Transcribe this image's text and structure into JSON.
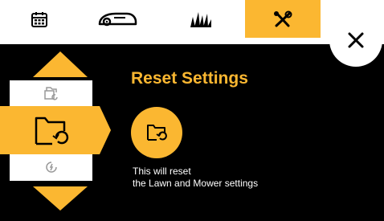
{
  "tabs": [
    {
      "id": "calendar",
      "icon": "calendar-icon",
      "active": false
    },
    {
      "id": "mower",
      "icon": "mower-icon",
      "active": false
    },
    {
      "id": "lawn",
      "icon": "grass-icon",
      "active": false
    },
    {
      "id": "settings",
      "icon": "tools-icon",
      "active": true
    }
  ],
  "close": {
    "icon": "close-icon"
  },
  "menu": {
    "items": [
      {
        "icon": "settings-item-icon",
        "state": "above"
      },
      {
        "icon": "folder-reset-icon",
        "state": "selected"
      },
      {
        "icon": "power-reset-icon",
        "state": "below"
      }
    ]
  },
  "main": {
    "title": "Reset Settings",
    "icon": "folder-reset-icon",
    "description_line1": "This will reset",
    "description_line2": "the Lawn and Mower settings"
  },
  "colors": {
    "accent": "#fbb731",
    "background": "#000000",
    "surface": "#ffffff"
  }
}
